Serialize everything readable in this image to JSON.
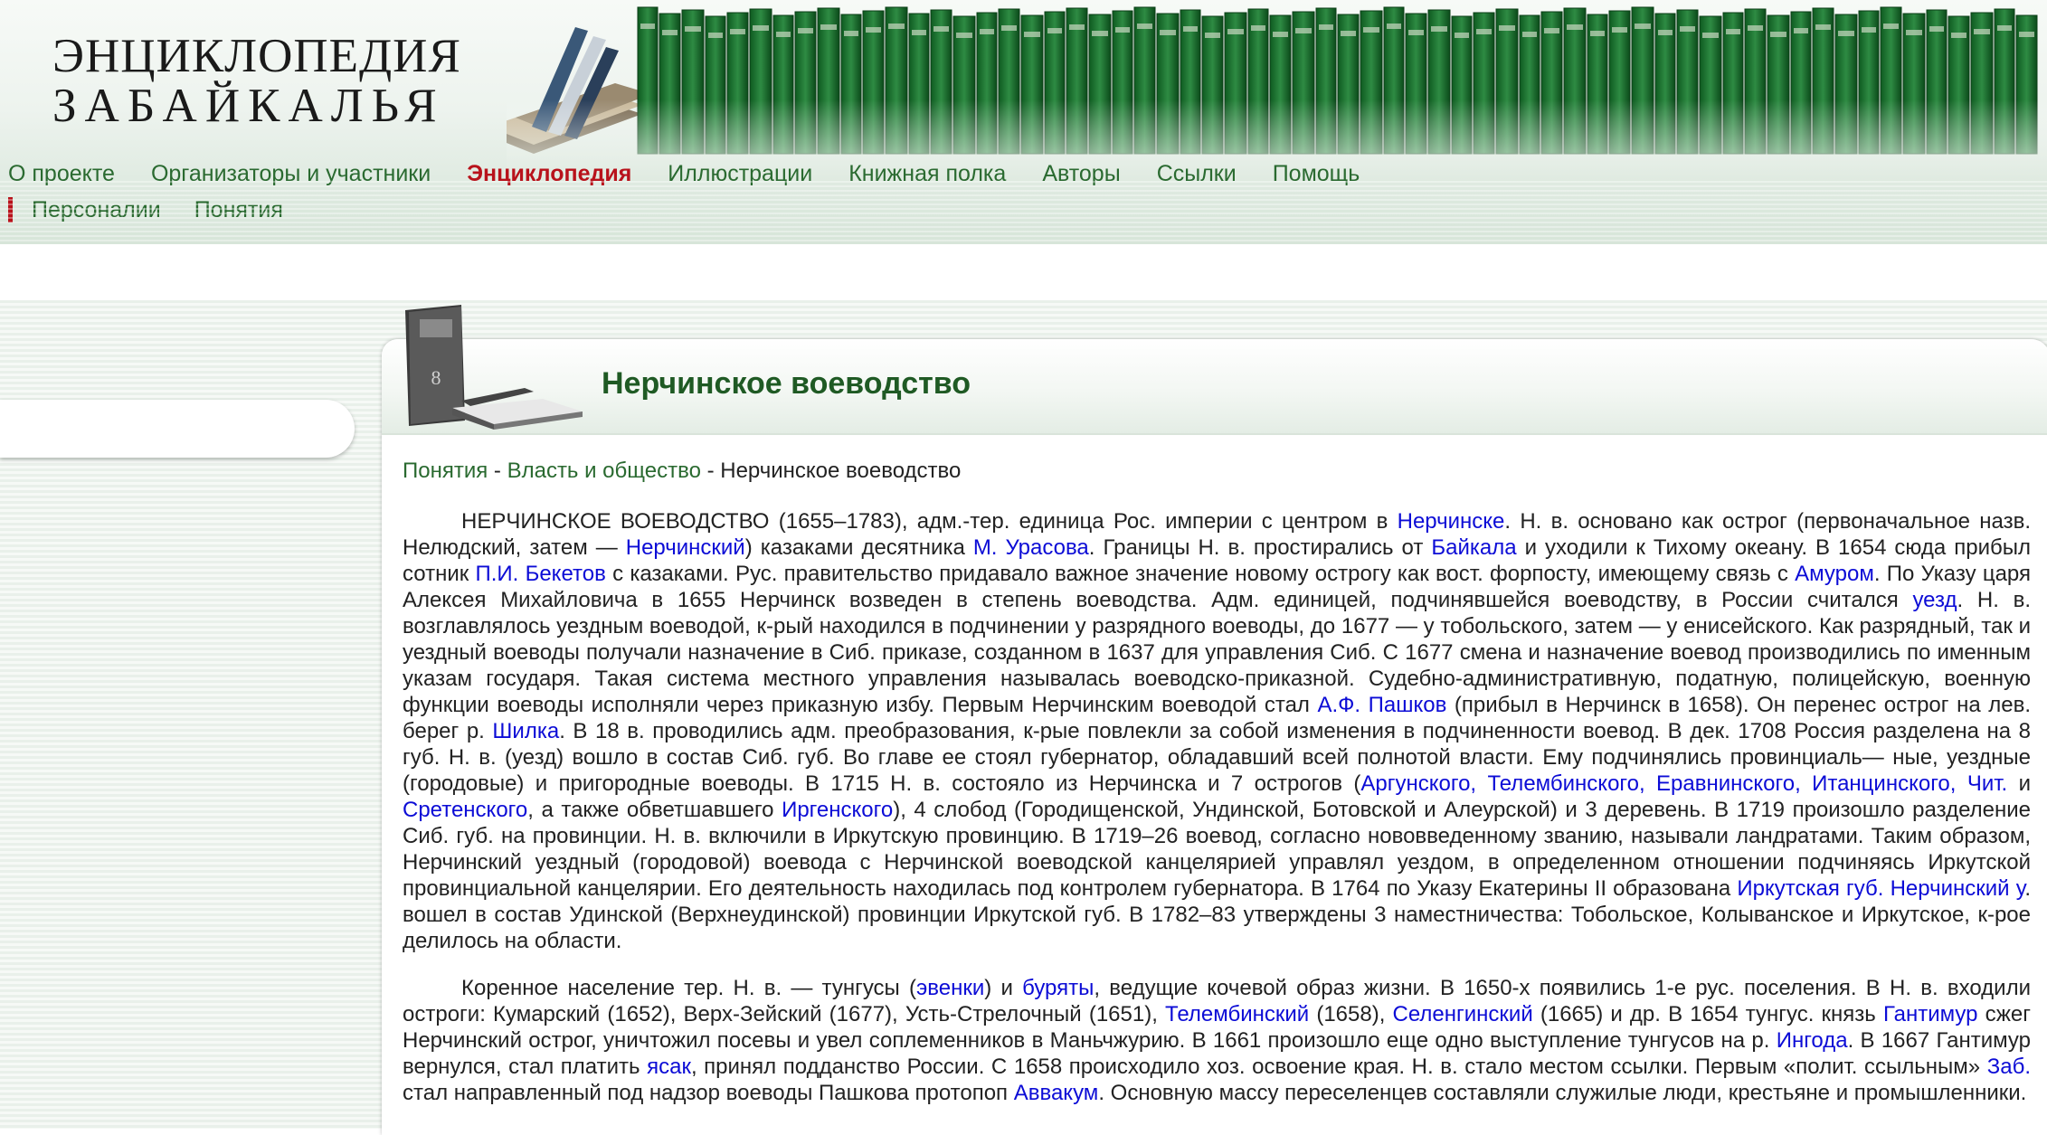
{
  "logo": {
    "line1": "ЭНЦИКЛОПЕДИЯ",
    "line2": "ЗАБАЙКАЛЬЯ"
  },
  "nav": {
    "main": [
      {
        "label": "О проекте",
        "active": false
      },
      {
        "label": "Организаторы и участники",
        "active": false
      },
      {
        "label": "Энциклопедия",
        "active": true
      },
      {
        "label": "Иллюстрации",
        "active": false
      },
      {
        "label": "Книжная полка",
        "active": false
      },
      {
        "label": "Авторы",
        "active": false
      },
      {
        "label": "Ссылки",
        "active": false
      },
      {
        "label": "Помощь",
        "active": false
      }
    ],
    "sub": [
      {
        "label": "Персоналии"
      },
      {
        "label": "Понятия"
      }
    ]
  },
  "page": {
    "title": "Нерчинское воеводство"
  },
  "breadcrumb": {
    "items": [
      "Понятия",
      "Власть и общество",
      "Нерчинское воеводство"
    ],
    "separator": " - "
  },
  "article": {
    "paragraphs": [
      [
        {
          "t": "НЕРЧИНСКОЕ ВОЕВОДСТВО (1655–1783), адм.-тер. единица Рос. империи с центром в "
        },
        {
          "t": "Нерчинске",
          "link": true
        },
        {
          "t": ". Н. в. основано как острог (первоначальное назв. Нелюдский, затем — "
        },
        {
          "t": "Нерчинский",
          "link": true
        },
        {
          "t": ") казаками десятника "
        },
        {
          "t": "М. Урасова",
          "link": true
        },
        {
          "t": ". Границы Н. в. простирались от "
        },
        {
          "t": "Байкала",
          "link": true
        },
        {
          "t": " и уходили к Тихому океану. В 1654 сюда прибыл сотник "
        },
        {
          "t": "П.И. Бекетов",
          "link": true
        },
        {
          "t": " с казаками. Рус. правительство придавало важное значение новому острогу как вост. форпосту, имеющему связь с "
        },
        {
          "t": "Амуром",
          "link": true
        },
        {
          "t": ". По Указу царя Алексея Михайловича в 1655 Нерчинск возведен в степень воеводства. Адм. единицей, подчинявшейся воеводству, в России считался "
        },
        {
          "t": "уезд",
          "link": true
        },
        {
          "t": ". Н. в. возглавлялось уездным воеводой, к-рый находился в подчинении у разрядного воеводы, до 1677 — у тобольского, затем — у енисейского. Как разрядный, так и уездный воеводы получали назначение в Сиб. приказе, созданном в 1637 для управления Сиб. С 1677 смена и назначение воевод производились по именным указам государя. Такая система местного управления называлась воеводско-приказной. Судебно-административную, податную, полицейскую, военную функции воеводы исполняли через приказную избу. Первым Нерчинским воеводой стал "
        },
        {
          "t": "А.Ф. Пашков",
          "link": true
        },
        {
          "t": " (прибыл в Нерчинск в 1658). Он перенес острог на лев. берег р. "
        },
        {
          "t": "Шилка",
          "link": true
        },
        {
          "t": ". В 18 в. проводились адм. преобразования, к-рые повлекли за собой изменения в подчиненности воевод. В дек. 1708 Россия разделена на 8 губ. Н. в. (уезд) вошло в состав Сиб. губ. Во главе ее стоял губернатор, обладавший всей полнотой власти. Ему подчинялись провинциаль— ные, уездные (городовые) и пригородные воеводы. В 1715 Н. в. состояло из Нерчинска и 7 острогов ("
        },
        {
          "t": "Аргунского, Телембинского, Еравнинского, Итанцинского, Чит.",
          "link": true
        },
        {
          "t": " и "
        },
        {
          "t": "Сретенского",
          "link": true
        },
        {
          "t": ", а также обветшавшего "
        },
        {
          "t": "Иргенского",
          "link": true
        },
        {
          "t": "), 4 слобод (Городищенской, Ундинской, Ботовской и Алеурской) и 3 деревень. В 1719 произошло разделение Сиб. губ. на провинции. Н. в. включили в Иркутскую провинцию. В 1719–26 воевод, согласно нововведенному званию, называли ландратами. Таким образом, Нерчинский уездный (городовой) воевода с Нерчинской воеводской канцелярией управлял уездом, в определенном отношении подчиняясь Иркутской провинциальной канцелярии. Его деятельность находилась под контролем губернатора. В 1764 по Указу Екатерины II образована "
        },
        {
          "t": "Иркутская губ. Нерчинский у",
          "link": true
        },
        {
          "t": ". вошел в состав Удинской (Верхнеудинской) провинции Иркутской губ. В 1782–83 утверждены 3 наместничества: Тобольское, Колыванское и Иркутское, к-рое делилось на области."
        }
      ],
      [
        {
          "t": "Коренное население тер. Н. в. — тунгусы ("
        },
        {
          "t": "эвенки",
          "link": true
        },
        {
          "t": ") и "
        },
        {
          "t": "буряты",
          "link": true
        },
        {
          "t": ", ведущие кочевой образ жизни. В 1650-х появились 1-е рус. поселения. В Н. в. входили остроги: Кумарский (1652), Верх-Зейский (1677), Усть-Стрелочный (1651), "
        },
        {
          "t": "Телембинский",
          "link": true
        },
        {
          "t": " (1658), "
        },
        {
          "t": "Селенгинский",
          "link": true
        },
        {
          "t": " (1665) и др. В 1654 тунгус. князь "
        },
        {
          "t": "Гантимур",
          "link": true
        },
        {
          "t": " сжег Нерчинский острог, уничтожил посевы и увел соплеменников в Маньчжурию. В 1661 произошло еще одно выступление тунгусов на р. "
        },
        {
          "t": "Ингода",
          "link": true
        },
        {
          "t": ". В 1667 Гантимур вернулся, стал платить "
        },
        {
          "t": "ясак",
          "link": true
        },
        {
          "t": ", принял подданство России. С 1658 происходило хоз. освоение края. Н. в. стало местом ссылки. Первым «полит. ссыльным» "
        },
        {
          "t": "Заб.",
          "link": true
        },
        {
          "t": " стал направленный под надзор воеводы Пашкова протопоп "
        },
        {
          "t": "Аввакум",
          "link": true
        },
        {
          "t": ". Основную массу переселенцев составляли служилые люди, крестьяне и промышленники."
        }
      ]
    ]
  },
  "colors": {
    "nav_link": "#2a6a30",
    "nav_active": "#b8121b",
    "title": "#1f5a24",
    "link": "#0c0cd6",
    "text": "#222222"
  },
  "icons": {
    "books": "books-stack-icon"
  }
}
